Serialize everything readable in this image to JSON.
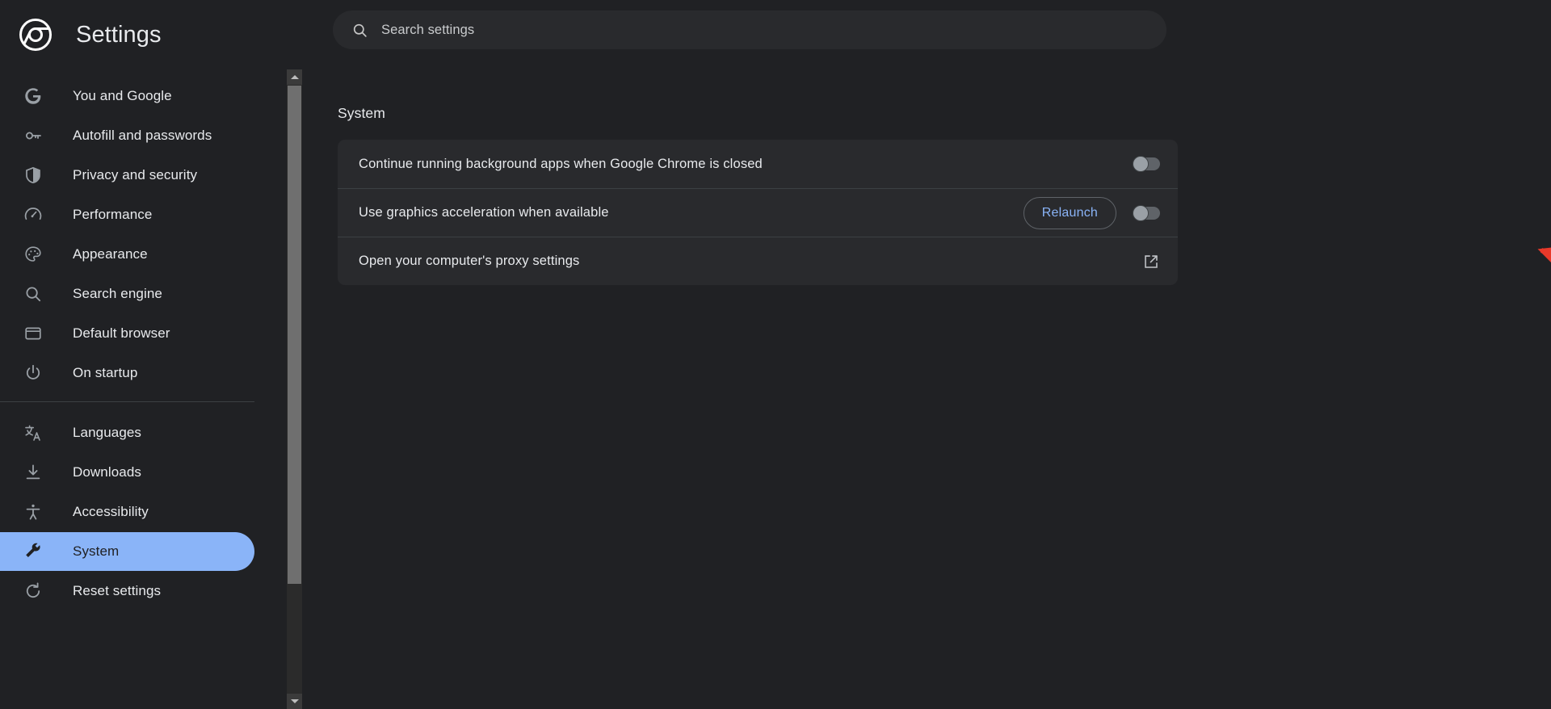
{
  "app": {
    "title": "Settings",
    "logo_icon": "chrome-logo-icon",
    "accent_color": "#8ab4f8",
    "background_color": "#202124",
    "card_color": "#292a2d"
  },
  "search": {
    "placeholder": "Search settings",
    "value": "",
    "icon": "search-icon"
  },
  "sidebar": {
    "groups": [
      {
        "items": [
          {
            "label": "You and Google",
            "icon": "google-g-icon",
            "selected": false
          },
          {
            "label": "Autofill and passwords",
            "icon": "key-icon",
            "selected": false
          },
          {
            "label": "Privacy and security",
            "icon": "shield-icon",
            "selected": false
          },
          {
            "label": "Performance",
            "icon": "speedometer-icon",
            "selected": false
          },
          {
            "label": "Appearance",
            "icon": "palette-icon",
            "selected": false
          },
          {
            "label": "Search engine",
            "icon": "magnifier-icon",
            "selected": false
          },
          {
            "label": "Default browser",
            "icon": "browser-window-icon",
            "selected": false
          },
          {
            "label": "On startup",
            "icon": "power-icon",
            "selected": false
          }
        ]
      },
      {
        "items": [
          {
            "label": "Languages",
            "icon": "translate-icon",
            "selected": false
          },
          {
            "label": "Downloads",
            "icon": "download-icon",
            "selected": false
          },
          {
            "label": "Accessibility",
            "icon": "accessibility-icon",
            "selected": false
          },
          {
            "label": "System",
            "icon": "wrench-icon",
            "selected": true
          },
          {
            "label": "Reset settings",
            "icon": "restore-icon",
            "selected": false
          }
        ]
      }
    ]
  },
  "main": {
    "section_title": "System",
    "rows": [
      {
        "label": "Continue running background apps when Google Chrome is closed",
        "control": "toggle",
        "toggle_state": "off",
        "button": null
      },
      {
        "label": "Use graphics acceleration when available",
        "control": "toggle",
        "toggle_state": "off",
        "button": "Relaunch"
      },
      {
        "label": "Open your computer's proxy settings",
        "control": "external-link",
        "toggle_state": null,
        "button": null
      }
    ]
  },
  "annotation": {
    "type": "arrow",
    "color": "#e8392a",
    "points_to": "graphics-acceleration-toggle"
  },
  "scrollbar": {
    "up_arrow": "scroll-up-arrow-icon",
    "down_arrow": "scroll-down-arrow-icon"
  }
}
